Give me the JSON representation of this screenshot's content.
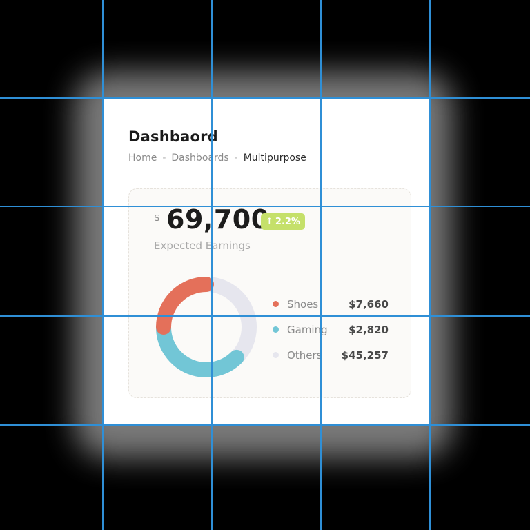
{
  "page": {
    "title": "Dashbaord",
    "breadcrumb": {
      "items": [
        "Home",
        "Dashboards"
      ],
      "separator": "-",
      "current": "Multipurpose"
    }
  },
  "earnings": {
    "currency_symbol": "$",
    "amount": "69,700",
    "change": {
      "icon": "arrow-up-icon",
      "icon_glyph": "↑",
      "value": "2.2%",
      "color": "#c5e06a"
    },
    "label": "Expected Earnings"
  },
  "chart_data": {
    "type": "pie",
    "categories": [
      "Shoes",
      "Gaming",
      "Others"
    ],
    "values": [
      7660,
      2820,
      45257
    ],
    "value_labels": [
      "$7,660",
      "$2,820",
      "$45,257"
    ],
    "colors": [
      "#e4705a",
      "#72c6d6",
      "#e6e6ee"
    ],
    "displayed_share_percent": [
      25,
      37.5,
      37.5
    ],
    "legend_placement": "right"
  },
  "legend": [
    {
      "label": "Shoes",
      "value": "$7,660",
      "color": "#e4705a"
    },
    {
      "label": "Gaming",
      "value": "$2,820",
      "color": "#72c6d6"
    },
    {
      "label": "Others",
      "value": "$45,257",
      "color": "#e6e6ee"
    }
  ],
  "theme": {
    "accent_grid": "#2f8fd6",
    "background": "#000000",
    "card": "#ffffff"
  }
}
